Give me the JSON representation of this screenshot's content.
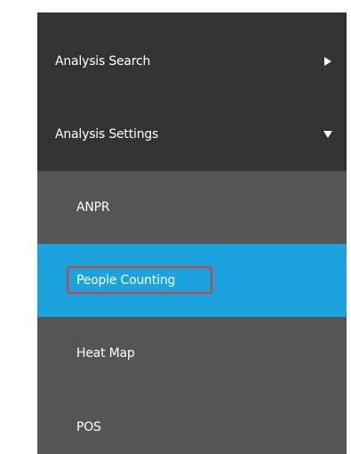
{
  "menu": {
    "analysis_search": {
      "label": "Analysis Search",
      "arrow_icon": "triangle-right-icon",
      "expanded": false
    },
    "analysis_settings": {
      "label": "Analysis Settings",
      "arrow_icon": "triangle-down-icon",
      "expanded": true,
      "children": [
        {
          "label": "ANPR",
          "active": false
        },
        {
          "label": "People Counting",
          "active": true,
          "highlighted": true
        },
        {
          "label": "Heat Map",
          "active": false
        },
        {
          "label": "POS",
          "active": false
        }
      ]
    }
  },
  "colors": {
    "parent_bg": "#333333",
    "child_bg": "#555555",
    "active_bg": "#1aa3dd",
    "text": "#ffffff",
    "highlight_border": "#e53935"
  }
}
